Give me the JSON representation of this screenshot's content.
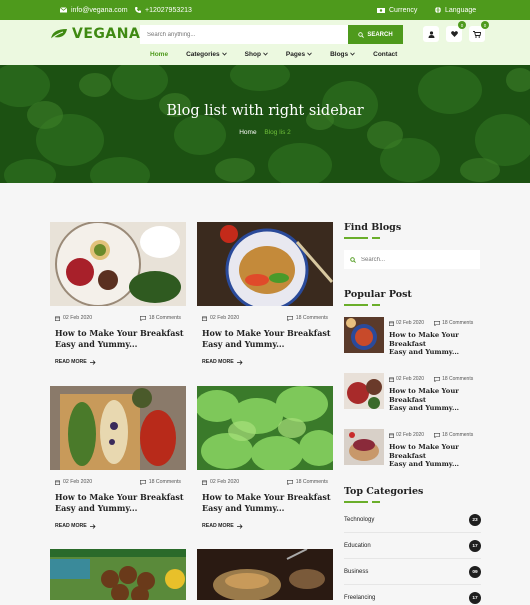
{
  "topbar": {
    "email": "info@vegana.com",
    "phone": "+12027953213",
    "currency": "Currency",
    "language": "Language"
  },
  "header": {
    "logo": "VEGANA",
    "search_placeholder": "Search anything...",
    "search_button": "SEARCH",
    "wishlist_count": "0",
    "cart_count": "0"
  },
  "nav": [
    "Home",
    "Categories",
    "Shop",
    "Pages",
    "Blogs",
    "Contact"
  ],
  "hero": {
    "title": "Blog list with right sidebar",
    "crumb_home": "Home",
    "crumb_current": "Blog lis 2"
  },
  "posts": [
    {
      "date": "02 Feb 2020",
      "comments": "18 Comments",
      "title_1": "How to Make Your Breakfast",
      "title_2": "Easy and Yummy...",
      "more": "READ MORE"
    },
    {
      "date": "02 Feb 2020",
      "comments": "18 Comments",
      "title_1": "How to Make Your Breakfast",
      "title_2": "Easy and Yummy...",
      "more": "READ MORE"
    },
    {
      "date": "02 Feb 2020",
      "comments": "18 Comments",
      "title_1": "How to Make Your Breakfast",
      "title_2": "Easy and Yummy...",
      "more": "READ MORE"
    },
    {
      "date": "02 Feb 2020",
      "comments": "18 Comments",
      "title_1": "How to Make Your Breakfast",
      "title_2": "Easy and Yummy...",
      "more": "READ MORE"
    }
  ],
  "sidebar": {
    "find_title": "Find Blogs",
    "search_placeholder": "Search...",
    "popular_title": "Popular Post",
    "popular": [
      {
        "date": "02 Feb 2020",
        "comments": "18 Comments",
        "title_1": "How to Make Your Breakfast",
        "title_2": "Easy and Yummy..."
      },
      {
        "date": "02 Feb 2020",
        "comments": "18 Comments",
        "title_1": "How to Make Your Breakfast",
        "title_2": "Easy and Yummy..."
      },
      {
        "date": "02 Feb 2020",
        "comments": "18 Comments",
        "title_1": "How to Make Your Breakfast",
        "title_2": "Easy and Yummy..."
      }
    ],
    "categories_title": "Top Categories",
    "categories": [
      {
        "name": "Technology",
        "count": "23"
      },
      {
        "name": "Education",
        "count": "17"
      },
      {
        "name": "Business",
        "count": "09"
      },
      {
        "name": "Freelancing",
        "count": "17"
      }
    ]
  },
  "colors": {
    "brand": "#4e9a1c",
    "header_bg": "#ecf9e0",
    "badge_dark": "#1e1e1e"
  }
}
